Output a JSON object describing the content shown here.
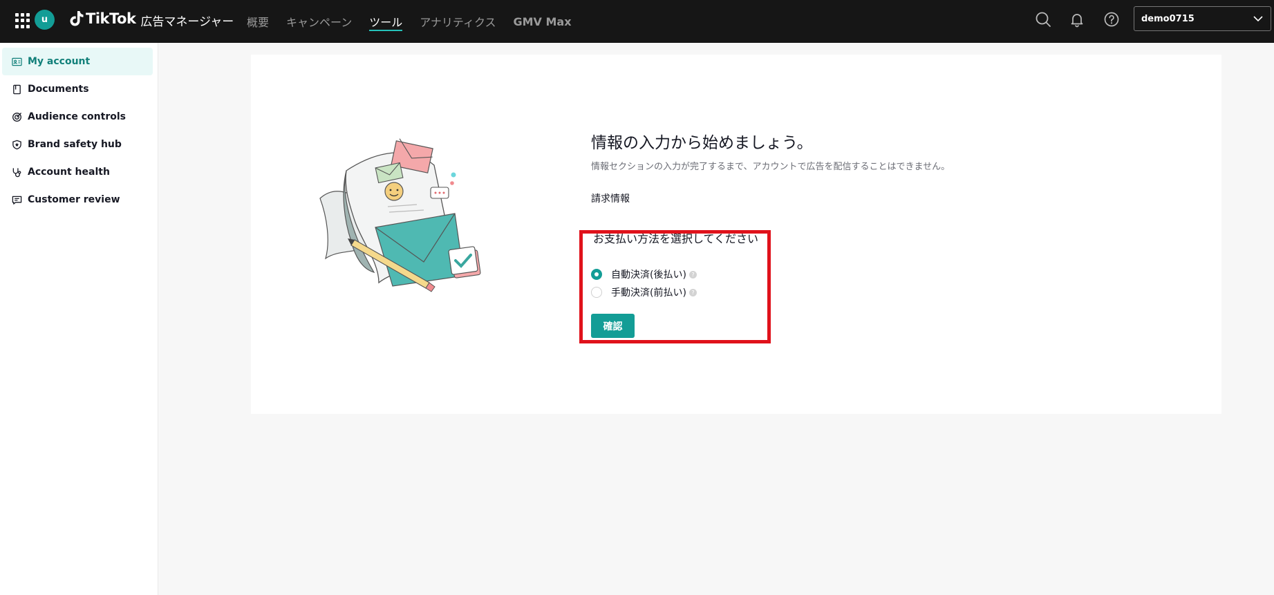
{
  "topbar": {
    "avatar_letter": "u",
    "brand_name": "TikTok",
    "brand_sub": "広告マネージャー",
    "nav": [
      {
        "label": "概要"
      },
      {
        "label": "キャンペーン"
      },
      {
        "label": "ツール"
      },
      {
        "label": "アナリティクス"
      },
      {
        "label": "GMV Max"
      }
    ],
    "active_nav": "ツール",
    "account_name": "demo0715"
  },
  "sidebar": {
    "items": [
      {
        "label": "My account",
        "icon": "id-card-icon"
      },
      {
        "label": "Documents",
        "icon": "document-icon"
      },
      {
        "label": "Audience controls",
        "icon": "target-icon"
      },
      {
        "label": "Brand safety hub",
        "icon": "shield-icon"
      },
      {
        "label": "Account health",
        "icon": "stethoscope-icon"
      },
      {
        "label": "Customer review",
        "icon": "chat-icon"
      }
    ],
    "active_item": "My account"
  },
  "main": {
    "title": "情報の入力から始めましょう。",
    "subtitle": "情報セクションの入力が完了するまで、アカウントで広告を配信することはできません。",
    "section_label": "請求情報",
    "payment_label": "お支払い方法を選択してください",
    "options": [
      {
        "label": "自動決済(後払い)",
        "checked": true
      },
      {
        "label": "手動決済(前払い)",
        "checked": false
      }
    ],
    "help_glyph": "?",
    "confirm_label": "確認"
  },
  "colors": {
    "accent": "#139d96",
    "topbar_bg": "#161616",
    "highlight": "#e0121b"
  }
}
